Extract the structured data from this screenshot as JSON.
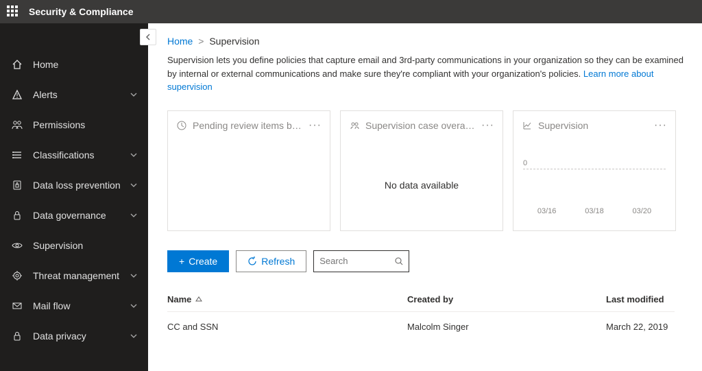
{
  "header": {
    "title": "Security & Compliance"
  },
  "sidebar": {
    "items": [
      {
        "label": "Home",
        "icon": "home",
        "expandable": false
      },
      {
        "label": "Alerts",
        "icon": "alert",
        "expandable": true
      },
      {
        "label": "Permissions",
        "icon": "permissions",
        "expandable": false
      },
      {
        "label": "Classifications",
        "icon": "classifications",
        "expandable": true
      },
      {
        "label": "Data loss prevention",
        "icon": "dlp",
        "expandable": true
      },
      {
        "label": "Data governance",
        "icon": "lock",
        "expandable": true
      },
      {
        "label": "Supervision",
        "icon": "eye",
        "expandable": false
      },
      {
        "label": "Threat management",
        "icon": "threat",
        "expandable": true
      },
      {
        "label": "Mail flow",
        "icon": "mail",
        "expandable": true
      },
      {
        "label": "Data privacy",
        "icon": "lock",
        "expandable": true
      }
    ]
  },
  "breadcrumb": {
    "home": "Home",
    "sep": ">",
    "current": "Supervision"
  },
  "description": {
    "text": "Supervision lets you define policies that capture email and 3rd-party communications in your organization so they can be examined by internal or external communications and make sure they're compliant with your organization's policies. ",
    "link": "Learn more about supervision"
  },
  "cards": [
    {
      "title": "Pending review items by p...",
      "icon": "clock",
      "body": ""
    },
    {
      "title": "Supervision case overall p...",
      "icon": "people",
      "body": "No data available"
    },
    {
      "title": "Supervision",
      "icon": "chart",
      "chart": {
        "zero": "0",
        "x": [
          "03/16",
          "03/18",
          "03/20"
        ]
      }
    }
  ],
  "toolbar": {
    "create": "Create",
    "refresh": "Refresh",
    "searchPlaceholder": "Search"
  },
  "table": {
    "columns": {
      "name": "Name",
      "created": "Created by",
      "modified": "Last modified"
    },
    "rows": [
      {
        "name": "CC and SSN",
        "created": "Malcolm Singer",
        "modified": "March 22, 2019"
      }
    ]
  }
}
